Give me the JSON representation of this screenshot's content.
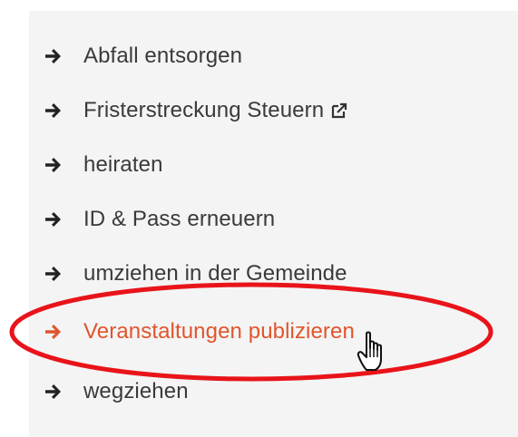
{
  "links": {
    "items": [
      {
        "label": "Abfall entsorgen",
        "icon": "arrow-right-icon",
        "external": false,
        "active": false
      },
      {
        "label": "Fristerstreckung Steuern",
        "icon": "arrow-right-icon",
        "external": true,
        "external_icon": "external-link-icon",
        "active": false
      },
      {
        "label": "heiraten",
        "icon": "arrow-right-icon",
        "external": false,
        "active": false
      },
      {
        "label": "ID & Pass erneuern",
        "icon": "arrow-right-icon",
        "external": false,
        "active": false
      },
      {
        "label": "umziehen in der Gemeinde",
        "icon": "arrow-right-icon",
        "external": false,
        "active": false
      },
      {
        "label": "Veranstaltungen publizieren",
        "icon": "arrow-right-icon",
        "external": false,
        "active": true
      },
      {
        "label": "wegziehen",
        "icon": "arrow-right-icon",
        "external": false,
        "active": false
      }
    ]
  },
  "annotation": {
    "shape": "ellipse",
    "color": "#e8141a",
    "target": "Veranstaltungen publizieren"
  },
  "cursor": {
    "type": "hand-pointer-icon"
  },
  "colors": {
    "text": "#3a3a3a",
    "active": "#e0552d",
    "panel_background": "#f4f4f4",
    "arrow": "#222222"
  }
}
